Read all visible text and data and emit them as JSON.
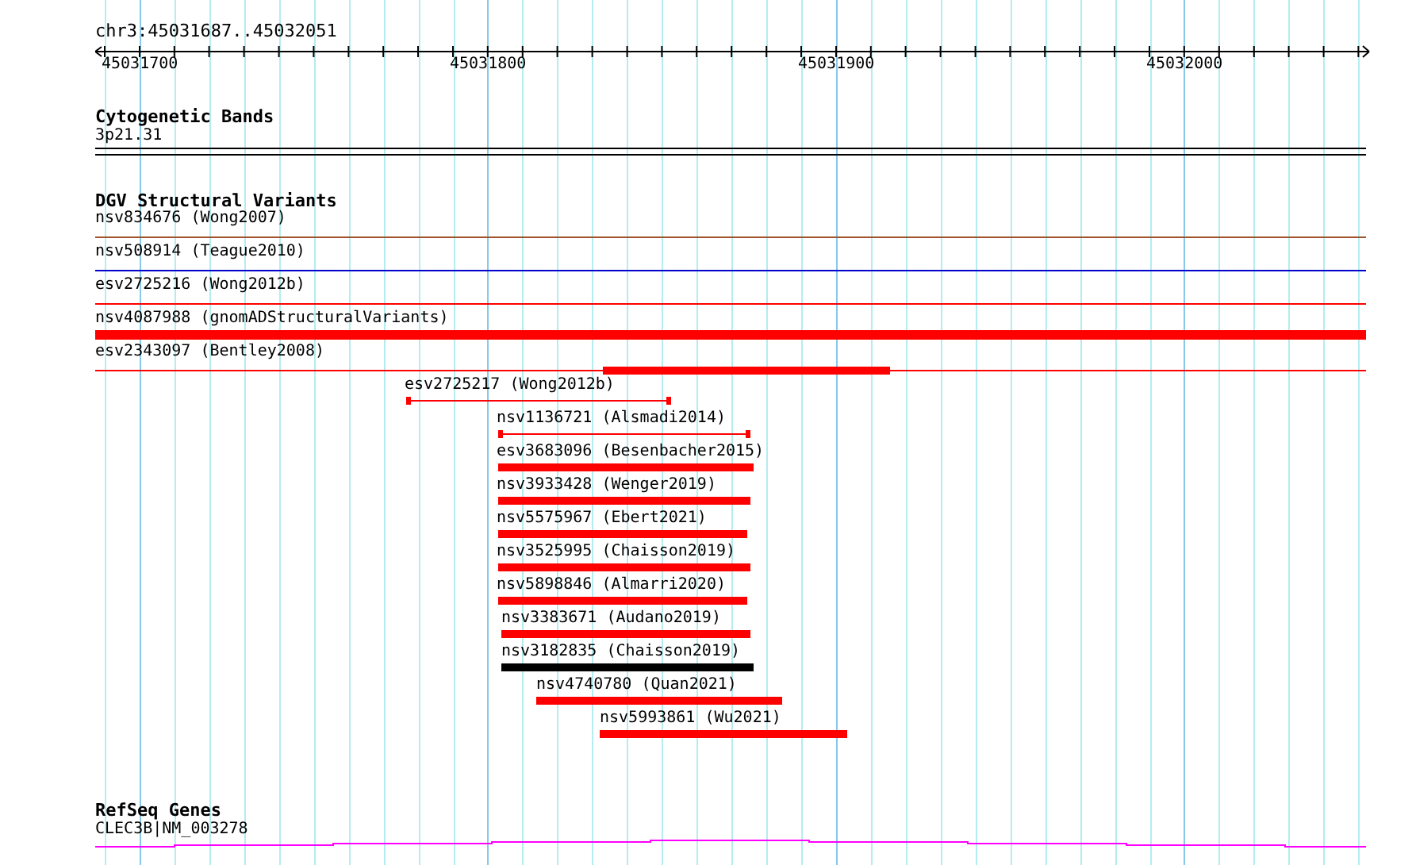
{
  "ruler": {
    "location": "chr3:45031687..45032051",
    "ticks": [
      "45031700",
      "45031800",
      "45031900",
      "45032000"
    ]
  },
  "cytogenetic_bands": {
    "title": "Cytogenetic Bands",
    "features": [
      {
        "label": "3p21.31",
        "kind": "band"
      }
    ]
  },
  "dgv_structural_variants": {
    "title": "DGV Structural Variants",
    "features": [
      {
        "label": "nsv834676 (Wong2007)",
        "kind": "line",
        "color": "#a0522d"
      },
      {
        "label": "nsv508914 (Teague2010)",
        "kind": "line",
        "color": "#0000cc"
      },
      {
        "label": "esv2725216 (Wong2012b)",
        "kind": "line",
        "color": "#ff0000"
      },
      {
        "label": "nsv4087988 (gnomADStructuralVariants)",
        "kind": "bar",
        "color": "#ff0000"
      },
      {
        "label": "esv2343097 (Bentley2008)",
        "kind": "line-bar",
        "color": "#ff0000"
      },
      {
        "label": "esv2725217 (Wong2012b)",
        "kind": "span",
        "color": "#ff0000"
      },
      {
        "label": "nsv1136721 (Alsmadi2014)",
        "kind": "span",
        "color": "#ff0000"
      },
      {
        "label": "esv3683096 (Besenbacher2015)",
        "kind": "bar",
        "color": "#ff0000"
      },
      {
        "label": "nsv3933428 (Wenger2019)",
        "kind": "bar",
        "color": "#ff0000"
      },
      {
        "label": "nsv5575967 (Ebert2021)",
        "kind": "bar",
        "color": "#ff0000"
      },
      {
        "label": "nsv3525995 (Chaisson2019)",
        "kind": "bar",
        "color": "#ff0000"
      },
      {
        "label": "nsv5898846 (Almarri2020)",
        "kind": "bar",
        "color": "#ff0000"
      },
      {
        "label": "nsv3383671 (Audano2019)",
        "kind": "bar",
        "color": "#ff0000"
      },
      {
        "label": "nsv3182835 (Chaisson2019)",
        "kind": "bar",
        "color": "#000000"
      },
      {
        "label": "nsv4740780 (Quan2021)",
        "kind": "bar",
        "color": "#ff0000"
      },
      {
        "label": "nsv5993861 (Wu2021)",
        "kind": "bar",
        "color": "#ff0000"
      }
    ]
  },
  "refseq_genes": {
    "title": "RefSeq Genes",
    "features": [
      {
        "label": "CLEC3B|NM_003278",
        "kind": "gene",
        "color": "#ff00ff"
      }
    ]
  }
}
